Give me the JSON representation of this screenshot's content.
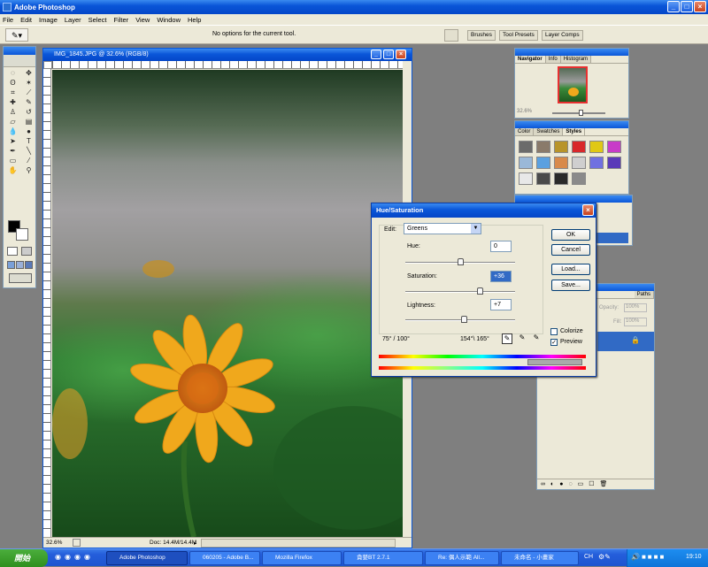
{
  "app": {
    "title": "Adobe Photoshop"
  },
  "menu": [
    "File",
    "Edit",
    "Image",
    "Layer",
    "Select",
    "Filter",
    "View",
    "Window",
    "Help"
  ],
  "options": {
    "message": "No options for the current tool.",
    "wells": [
      "Brushes",
      "Tool Presets",
      "Layer Comps"
    ]
  },
  "document": {
    "title": "IMG_1845.JPG @ 32.6% (RGB/8)",
    "zoom": "32.6%",
    "doc_size": "Doc: 14.4M/14.4M"
  },
  "navigator": {
    "tabs": [
      "Navigator",
      "Info",
      "Histogram"
    ],
    "zoom": "32.6%"
  },
  "styles_palette": {
    "tabs": [
      "Color",
      "Swatches",
      "Styles"
    ],
    "swatch_colors": [
      "#6b6b6b",
      "#8a7a6a",
      "#b8942a",
      "#d8282a",
      "#e0c814",
      "#c83cc8",
      "#9ab8d8",
      "#5aa0e0",
      "#d88a4a",
      "#cfcfcf",
      "#7070e0",
      "#5a3ab8",
      "#e8e8e8",
      "#4a4a4a",
      "#2a2a2a",
      "#8a8a8a"
    ]
  },
  "layers_palette": {
    "tabs": [
      "Paths"
    ],
    "opacity_label": "Opacity:",
    "opacity": "100%",
    "fill_label": "Fill:",
    "fill": "100%"
  },
  "dialog": {
    "title": "Hue/Saturation",
    "edit_label": "Edit:",
    "edit_value": "Greens",
    "hue_label": "Hue:",
    "hue": "0",
    "saturation_label": "Saturation:",
    "saturation": "+36",
    "lightness_label": "Lightness:",
    "lightness": "+7",
    "range_left": "75° / 100°",
    "range_right": "154°\\ 165°",
    "buttons": {
      "ok": "OK",
      "cancel": "Cancel",
      "load": "Load...",
      "save": "Save..."
    },
    "colorize": "Colorize",
    "preview": "Preview",
    "preview_checked": true,
    "slider_levels": {
      "hue": 0.5,
      "saturation": 0.68,
      "lightness": 0.53
    }
  },
  "taskbar": {
    "start": "開始",
    "tasks": [
      "Adobe Photoshop",
      "060205 - Adobe B...",
      "Mozilla Firefox",
      "貪婪BT 2.7.1",
      "Re: 偶人示範 All...",
      "未命名 - 小畫家"
    ],
    "lang": "CH",
    "clock": "19:10"
  }
}
